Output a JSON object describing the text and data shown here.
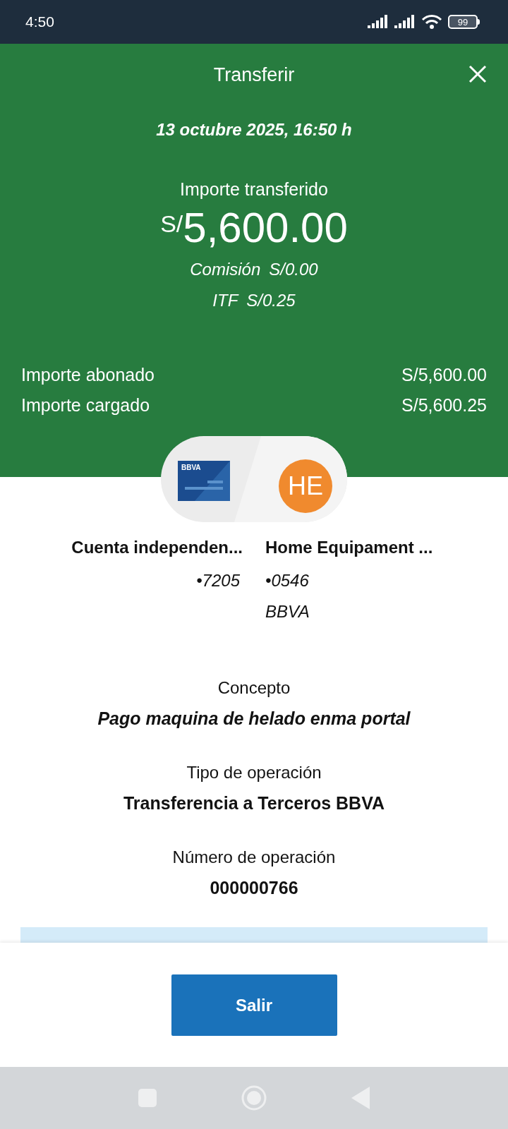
{
  "status_bar": {
    "time": "4:50",
    "battery": "99"
  },
  "header": {
    "title": "Transferir",
    "date": "13 octubre 2025, 16:50 h",
    "amount_label": "Importe transferido",
    "currency": "S/",
    "amount": "5,600.00",
    "fees": [
      {
        "label": "Comisión",
        "value": "S/0.00"
      },
      {
        "label": "ITF",
        "value": "S/0.25"
      }
    ]
  },
  "totals": [
    {
      "label": "Importe abonado",
      "value": "S/5,600.00"
    },
    {
      "label": "Importe cargado",
      "value": "S/5,600.25"
    }
  ],
  "origin": {
    "card_brand": "BBVA",
    "name": "Cuenta independen...",
    "number": "•7205"
  },
  "destination": {
    "initials": "HE",
    "name": "Home Equipament ...",
    "number": "•0546",
    "bank": "BBVA"
  },
  "details": [
    {
      "label": "Concepto",
      "value": "Pago maquina de helado enma portal",
      "italic": true
    },
    {
      "label": "Tipo de operación",
      "value": "Transferencia a Terceros BBVA",
      "italic": false
    },
    {
      "label": "Número de operación",
      "value": "000000766",
      "italic": false
    }
  ],
  "button": "Salir"
}
